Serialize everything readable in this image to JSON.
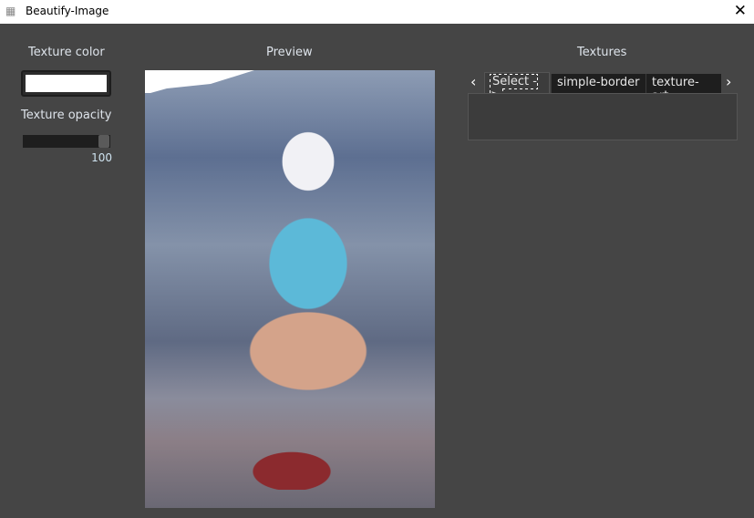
{
  "window": {
    "title": "Beautify-Image",
    "close": "✕"
  },
  "left": {
    "texture_color_label": "Texture color",
    "texture_color": "#ffffff",
    "opacity_label": "Texture opacity",
    "opacity_value": "100",
    "opacity_percent": 100
  },
  "preview": {
    "label": "Preview"
  },
  "textures": {
    "label": "Textures",
    "prev": "‹",
    "next": "›",
    "tabs": [
      "Select ->",
      "simple-border",
      "texture-art"
    ],
    "selected": 0
  }
}
